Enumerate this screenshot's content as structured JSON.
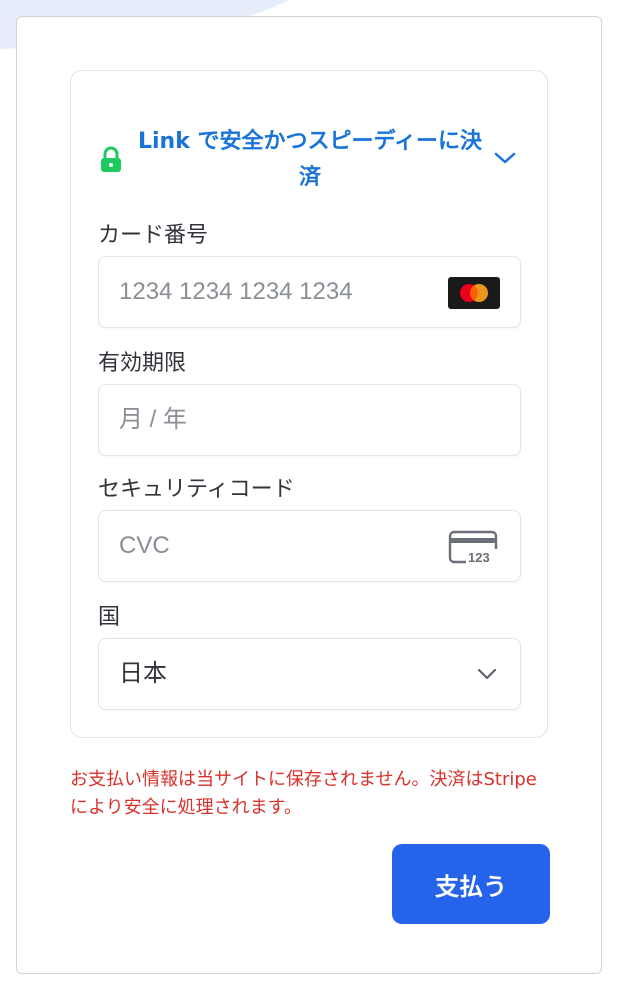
{
  "link": {
    "text": "Link で安全かつスピーディーに決済"
  },
  "card_number": {
    "label": "カード番号",
    "placeholder": "1234 1234 1234 1234",
    "brand_icon": "mastercard-icon"
  },
  "expiry": {
    "label": "有効期限",
    "placeholder": "月 / 年"
  },
  "security_code": {
    "label": "セキュリティコード",
    "placeholder": "CVC",
    "icon": "cvc-card-icon",
    "icon_text": "123"
  },
  "country": {
    "label": "国",
    "selected": "日本"
  },
  "notice": "お支払い情報は当サイトに保存されません。決済はStripeにより安全に処理されます。",
  "pay_button": {
    "label": "支払う"
  },
  "colors": {
    "link_blue": "#1a73d9",
    "lock_green": "#1ec95f",
    "error_red": "#d9322c",
    "button_blue": "#2563eb"
  }
}
